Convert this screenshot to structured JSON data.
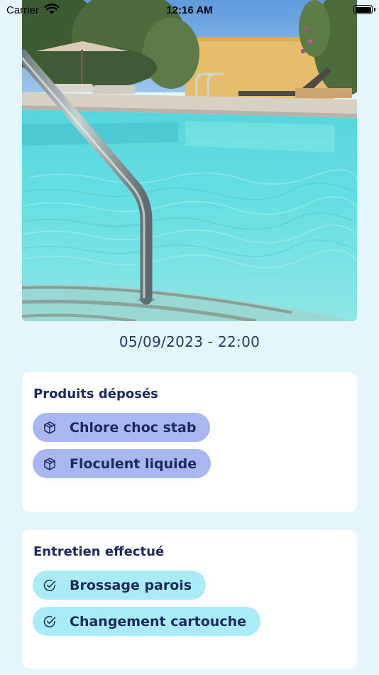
{
  "status_bar": {
    "carrier": "Carrier",
    "time": "12:16 AM",
    "wifi_icon": "wifi-icon",
    "battery_icon": "battery-icon"
  },
  "photo": {
    "subject": "pool-photo"
  },
  "report": {
    "datetime": "05/09/2023 - 22:00"
  },
  "products": {
    "title": "Produits déposés",
    "icon": "box-icon",
    "items": [
      {
        "label": "Chlore choc stab"
      },
      {
        "label": "Floculent liquide"
      }
    ]
  },
  "maintenance": {
    "title": "Entretien effectué",
    "icon": "check-circle-icon",
    "items": [
      {
        "label": "Brossage parois"
      },
      {
        "label": "Changement cartouche"
      }
    ]
  },
  "colors": {
    "background": "#e4f5fc",
    "card": "#ffffff",
    "text_primary": "#1c2a5c",
    "product_chip": "#a8b7f0",
    "task_chip": "#a9ecf8"
  }
}
